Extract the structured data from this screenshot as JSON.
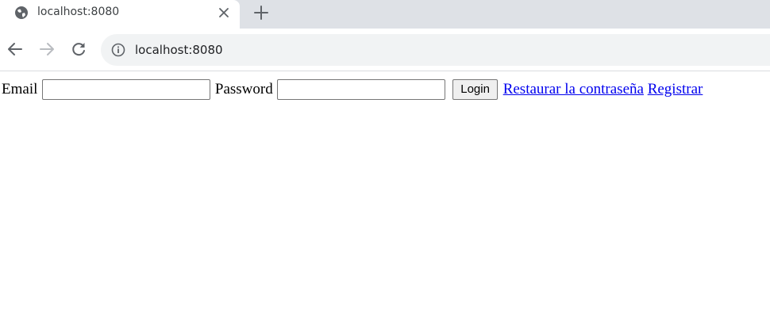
{
  "browser": {
    "tab_title": "localhost:8080",
    "url": "localhost:8080",
    "icons": {
      "favicon": "globe-icon",
      "tab_close": "close-icon",
      "new_tab": "plus-icon",
      "back": "back-arrow-icon",
      "forward": "forward-arrow-icon",
      "reload": "reload-icon",
      "site_info": "info-icon"
    }
  },
  "form": {
    "email_label": "Email",
    "email_value": "",
    "password_label": "Password",
    "password_value": "",
    "login_label": "Login",
    "reset_link": "Restaurar la contraseña",
    "register_link": "Registrar"
  },
  "colors": {
    "link": "#0000ee",
    "tabstrip": "#dee1e6",
    "omnibox": "#f1f3f4"
  }
}
